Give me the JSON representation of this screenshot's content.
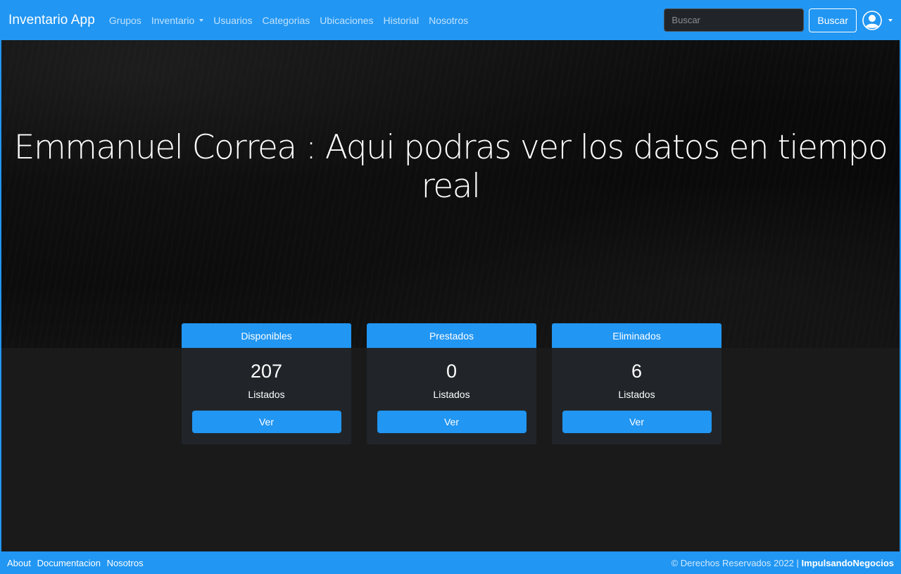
{
  "navbar": {
    "brand": "Inventario App",
    "links": [
      {
        "label": "Grupos"
      },
      {
        "label": "Inventario"
      },
      {
        "label": "Usuarios"
      },
      {
        "label": "Categorias"
      },
      {
        "label": "Ubicaciones"
      },
      {
        "label": "Historial"
      },
      {
        "label": "Nosotros"
      }
    ],
    "search": {
      "placeholder": "Buscar",
      "value": "",
      "button_label": "Buscar"
    },
    "user_icon": "user-circle-icon"
  },
  "hero": {
    "title": "Emmanuel Correa : Aqui podras ver los datos en tiempo real"
  },
  "cards": [
    {
      "title": "Disponibles",
      "count": "207",
      "subtitle": "Listados",
      "button_label": "Ver"
    },
    {
      "title": "Prestados",
      "count": "0",
      "subtitle": "Listados",
      "button_label": "Ver"
    },
    {
      "title": "Eliminados",
      "count": "6",
      "subtitle": "Listados",
      "button_label": "Ver"
    }
  ],
  "footer": {
    "links": [
      "About",
      "Documentacion",
      "Nosotros"
    ],
    "copyright": "© Derechos Reservados 2022 |",
    "brand": "ImpulsandoNegocios"
  },
  "colors": {
    "primary": "#2196f3",
    "card_bg": "#212529",
    "page_bg": "#1a1a1b"
  }
}
